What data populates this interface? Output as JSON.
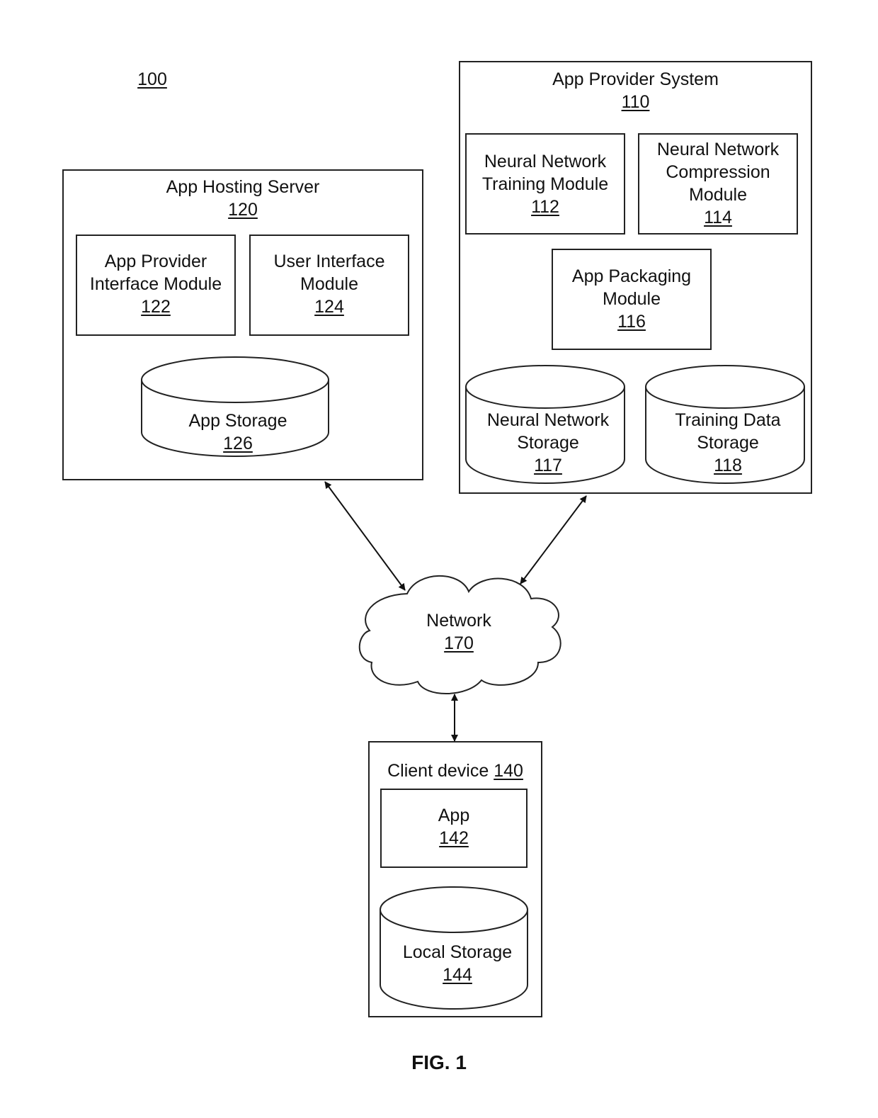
{
  "figure": {
    "ref": "100",
    "caption": "FIG. 1"
  },
  "app_provider_system": {
    "title": "App Provider System",
    "ref": "110",
    "training_module": {
      "line1": "Neural Network",
      "line2": "Training Module",
      "ref": "112"
    },
    "compression_module": {
      "line1": "Neural Network",
      "line2": "Compression",
      "line3": "Module",
      "ref": "114"
    },
    "packaging_module": {
      "line1": "App Packaging",
      "line2": "Module",
      "ref": "116"
    },
    "nn_storage": {
      "line1": "Neural Network",
      "line2": "Storage",
      "ref": "117"
    },
    "training_data_storage": {
      "line1": "Training Data",
      "line2": "Storage",
      "ref": "118"
    }
  },
  "app_hosting_server": {
    "title": "App Hosting Server",
    "ref": "120",
    "provider_interface_module": {
      "line1": "App Provider",
      "line2": "Interface Module",
      "ref": "122"
    },
    "user_interface_module": {
      "line1": "User Interface",
      "line2": "Module",
      "ref": "124"
    },
    "app_storage": {
      "line1": "App Storage",
      "ref": "126"
    }
  },
  "network": {
    "title": "Network",
    "ref": "170"
  },
  "client_device": {
    "title": "Client device",
    "ref": "140",
    "app": {
      "line1": "App",
      "ref": "142"
    },
    "local_storage": {
      "line1": "Local Storage",
      "ref": "144"
    }
  },
  "connections": [
    {
      "from": "App Hosting Server",
      "to": "Network",
      "direction": "bidirectional"
    },
    {
      "from": "App Provider System",
      "to": "Network",
      "direction": "bidirectional"
    },
    {
      "from": "Network",
      "to": "Client device",
      "direction": "bidirectional"
    }
  ]
}
